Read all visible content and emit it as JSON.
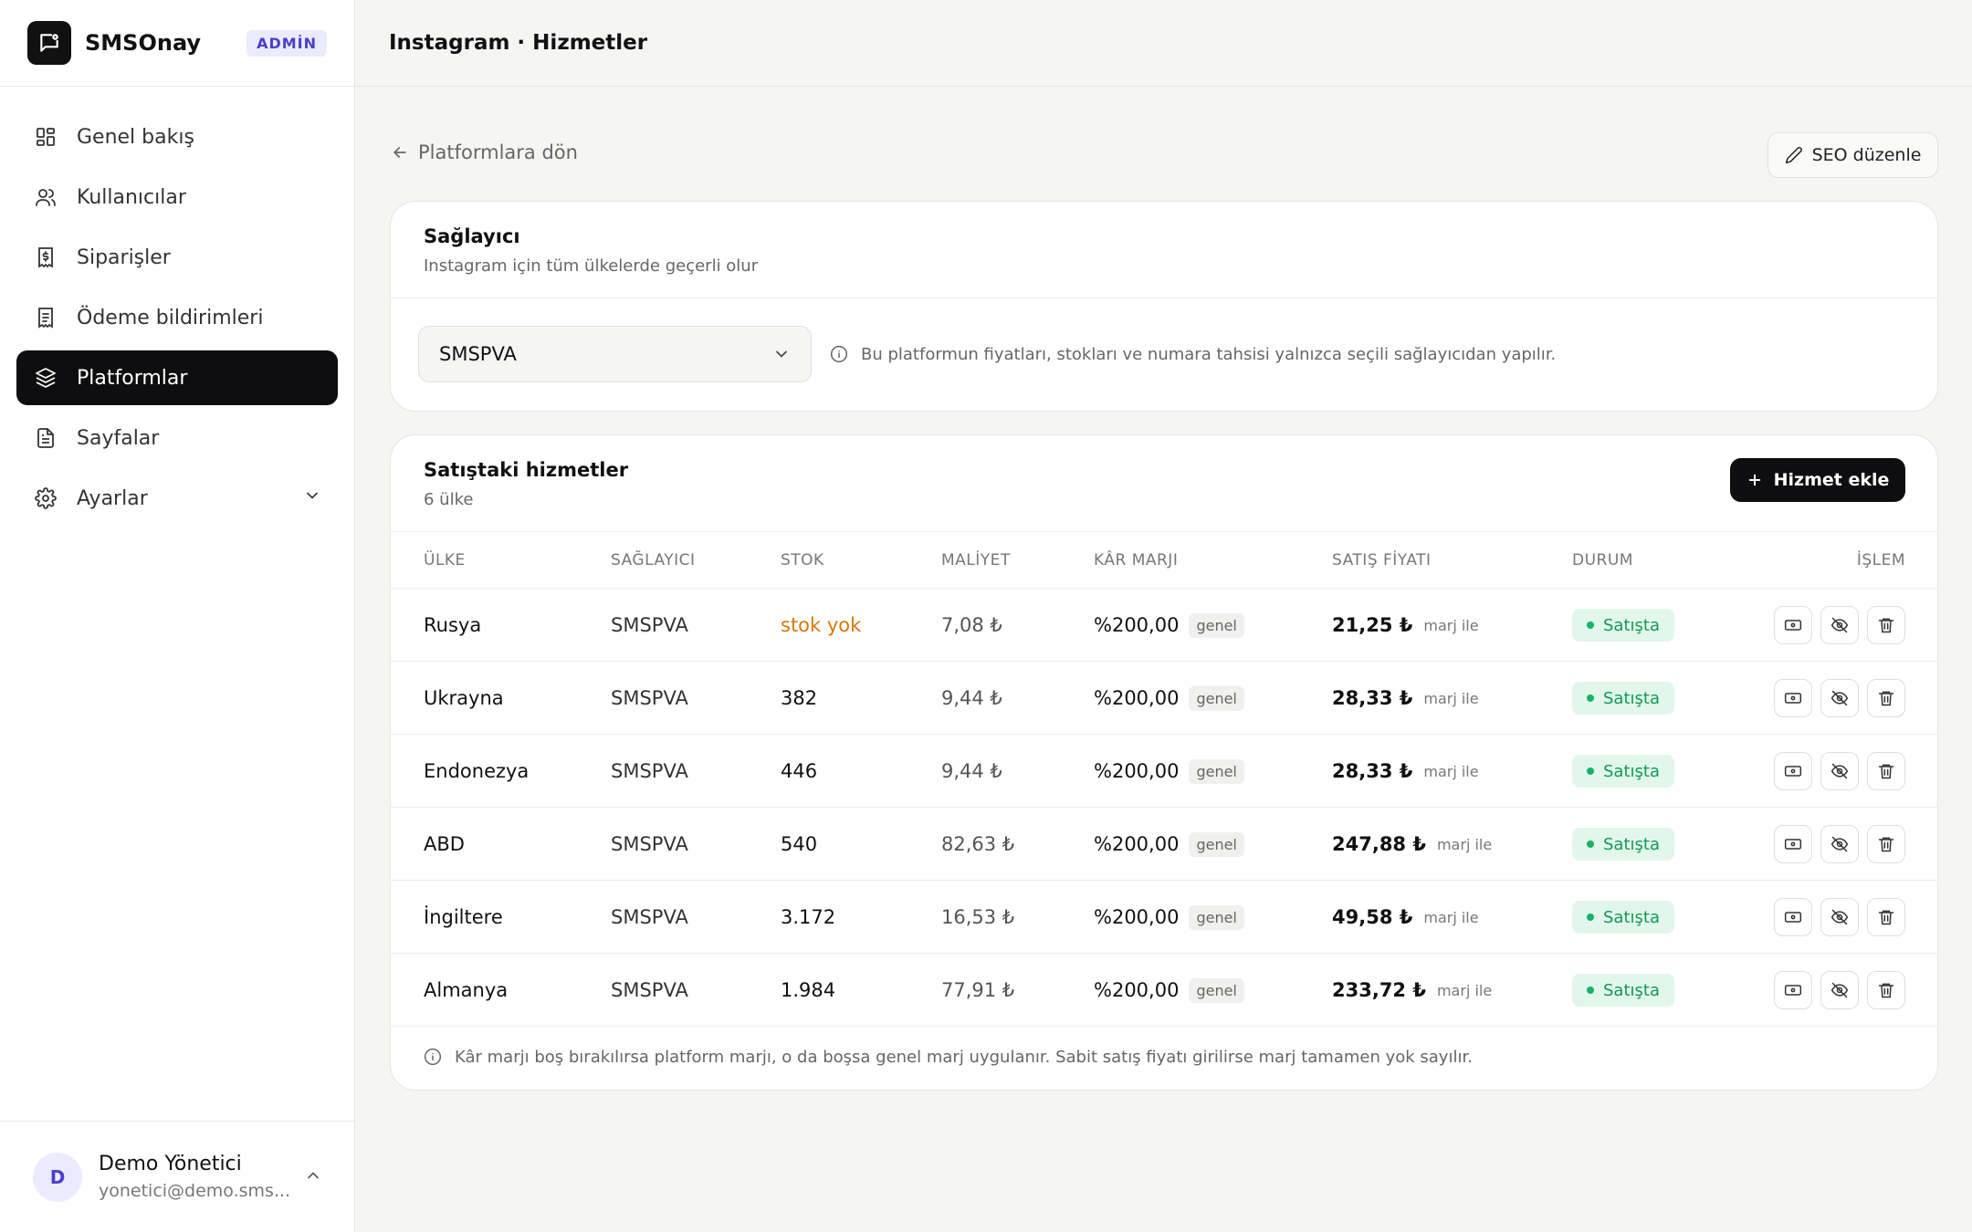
{
  "brand": {
    "name": "SMSOnay",
    "badge": "ADMİN"
  },
  "sidebar": {
    "items": [
      {
        "label": "Genel bakış",
        "icon": "dashboard-icon"
      },
      {
        "label": "Kullanıcılar",
        "icon": "users-icon"
      },
      {
        "label": "Siparişler",
        "icon": "receipt-icon"
      },
      {
        "label": "Ödeme bildirimleri",
        "icon": "document-icon"
      },
      {
        "label": "Platformlar",
        "icon": "layers-icon",
        "active": true
      },
      {
        "label": "Sayfalar",
        "icon": "file-icon"
      },
      {
        "label": "Ayarlar",
        "icon": "gear-icon"
      }
    ]
  },
  "user": {
    "initial": "D",
    "name": "Demo Yönetici",
    "email": "yonetici@demo.sms..."
  },
  "header": {
    "title": "Instagram · Hizmetler"
  },
  "nav": {
    "back_label": "Platformlara dön",
    "seo_label": "SEO düzenle"
  },
  "provider_card": {
    "title": "Sağlayıcı",
    "subtitle": "Instagram için tüm ülkelerde geçerli olur",
    "selected": "SMSPVA",
    "hint": "Bu platformun fiyatları, stokları ve numara tahsisi yalnızca seçili sağlayıcıdan yapılır."
  },
  "services_card": {
    "title": "Satıştaki hizmetler",
    "count": "6 ülke",
    "add_label": "Hizmet ekle",
    "columns": [
      "ÜLKE",
      "SAĞLAYICI",
      "STOK",
      "MALİYET",
      "KÂR MARJI",
      "SATIŞ FİYATI",
      "DURUM",
      "İŞLEM"
    ],
    "rows": [
      {
        "country": "Rusya",
        "provider": "SMSPVA",
        "stock": "stok yok",
        "cost": "7,08 ₺",
        "margin": "%200,00",
        "margin_tag": "genel",
        "price": "21,25 ₺",
        "price_note": "marj ile",
        "status": "Satışta"
      },
      {
        "country": "Ukrayna",
        "provider": "SMSPVA",
        "stock": "382",
        "cost": "9,44 ₺",
        "margin": "%200,00",
        "margin_tag": "genel",
        "price": "28,33 ₺",
        "price_note": "marj ile",
        "status": "Satışta"
      },
      {
        "country": "Endonezya",
        "provider": "SMSPVA",
        "stock": "446",
        "cost": "9,44 ₺",
        "margin": "%200,00",
        "margin_tag": "genel",
        "price": "28,33 ₺",
        "price_note": "marj ile",
        "status": "Satışta"
      },
      {
        "country": "ABD",
        "provider": "SMSPVA",
        "stock": "540",
        "cost": "82,63 ₺",
        "margin": "%200,00",
        "margin_tag": "genel",
        "price": "247,88 ₺",
        "price_note": "marj ile",
        "status": "Satışta"
      },
      {
        "country": "İngiltere",
        "provider": "SMSPVA",
        "stock": "3.172",
        "cost": "16,53 ₺",
        "margin": "%200,00",
        "margin_tag": "genel",
        "price": "49,58 ₺",
        "price_note": "marj ile",
        "status": "Satışta"
      },
      {
        "country": "Almanya",
        "provider": "SMSPVA",
        "stock": "1.984",
        "cost": "77,91 ₺",
        "margin": "%200,00",
        "margin_tag": "genel",
        "price": "233,72 ₺",
        "price_note": "marj ile",
        "status": "Satışta"
      }
    ],
    "footer_note": "Kâr marjı boş bırakılırsa platform marjı, o da boşsa genel marj uygulanır. Sabit satış fiyatı girilirse marj tamamen yok sayılır."
  },
  "colors": {
    "accent": "#0e0e10",
    "badge": "#4a3fcf",
    "status_green": "#0f9a55",
    "out_of_stock": "#d97706"
  }
}
